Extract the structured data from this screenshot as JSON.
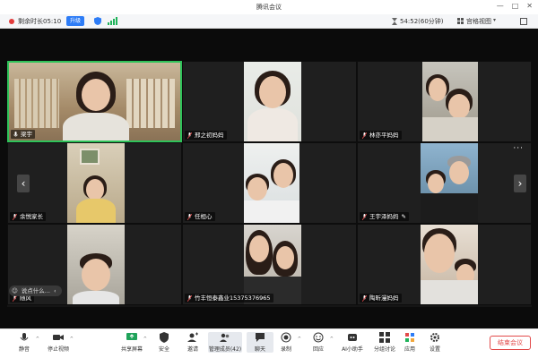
{
  "window": {
    "title": "腾讯会议"
  },
  "topbar": {
    "remaining_time": "剩余时长05:10",
    "upgrade_label": "升级",
    "duration": "54:52(60分钟)",
    "view_mode": "宫格视图"
  },
  "participants": [
    {
      "name": "梁宇",
      "row": 0,
      "col": 0,
      "active": true,
      "mic": "on"
    },
    {
      "name": "邢之初妈妈",
      "row": 0,
      "col": 1,
      "mic": "muted"
    },
    {
      "name": "林亦平妈妈",
      "row": 0,
      "col": 2,
      "mic": "muted"
    },
    {
      "name": "余悦家长",
      "row": 1,
      "col": 0,
      "mic": "muted"
    },
    {
      "name": "任桓心",
      "row": 1,
      "col": 1,
      "mic": "muted"
    },
    {
      "name": "王宇泽妈妈",
      "row": 1,
      "col": 2,
      "mic": "muted",
      "extra_icon": "pencil-icon"
    },
    {
      "name": "随风",
      "row": 2,
      "col": 0,
      "mic": "muted"
    },
    {
      "name": "竹丰恒泰鑫业15375376965",
      "row": 2,
      "col": 1,
      "mic": "muted"
    },
    {
      "name": "陶昕漫妈妈",
      "row": 2,
      "col": 2,
      "mic": "muted"
    }
  ],
  "chat_popup": {
    "placeholder": "说点什么..."
  },
  "toolbar": {
    "mute": "静音",
    "stop_video": "停止视频",
    "share_screen": "共享屏幕",
    "security": "安全",
    "invite": "邀请",
    "manage_members": "管理成员(42)",
    "chat": "聊天",
    "record": "录制",
    "reactions": "回应",
    "ai_assistant": "AI小助手",
    "breakout": "分组讨论",
    "apps": "应用",
    "settings": "设置",
    "end_meeting": "结束会议"
  },
  "colors": {
    "accent": "#2d7cf6",
    "active_border": "#2fc35a",
    "end_red": "#e24a4a",
    "signal_green": "#1fb35a",
    "timer_red": "#e23b3b"
  }
}
